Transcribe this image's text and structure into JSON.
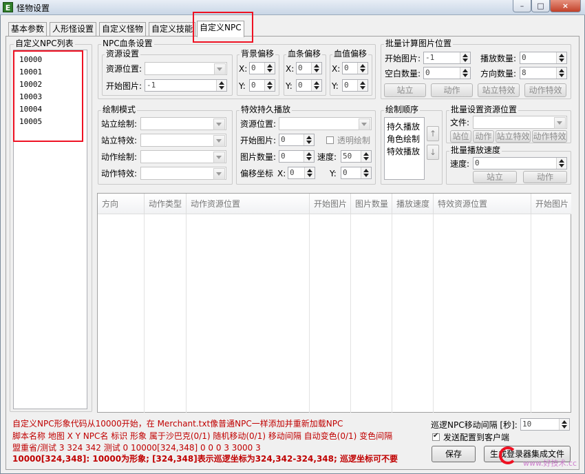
{
  "window": {
    "title": "怪物设置",
    "icon_letter": "E",
    "btn_minimize": "–",
    "btn_maximize": "□",
    "btn_close": "×"
  },
  "tabs": [
    "基本参数",
    "人形怪设置",
    "自定义怪物",
    "自定义技能",
    "自定义NPC"
  ],
  "npc_list": {
    "label": "自定义NPC列表",
    "items": [
      "10000",
      "10001",
      "10002",
      "10003",
      "10004",
      "10005"
    ]
  },
  "npc_hp": {
    "label": "NPC血条设置",
    "resource": {
      "label": "资源设置",
      "pos_label": "资源位置:",
      "start_label": "开始图片:",
      "start_value": "-1"
    },
    "bg_offset": {
      "label": "背景偏移",
      "x_label": "X:",
      "x": "0",
      "y_label": "Y:",
      "y": "0"
    },
    "bar_offset": {
      "label": "血条偏移",
      "x_label": "X:",
      "x": "0",
      "y_label": "Y:",
      "y": "0"
    },
    "val_offset": {
      "label": "血值偏移",
      "x_label": "X:",
      "x": "0",
      "y_label": "Y:",
      "y": "0"
    }
  },
  "batch_calc": {
    "label": "批量计算图片位置",
    "start_label": "开始图片:",
    "start_value": "-1",
    "count_label": "播放数量:",
    "count_value": "0",
    "blank_label": "空白数量:",
    "blank_value": "0",
    "dir_label": "方向数量:",
    "dir_value": "8",
    "buttons": [
      "站立",
      "动作",
      "站立特效",
      "动作特效"
    ]
  },
  "draw_mode": {
    "label": "绘制模式",
    "rows": [
      "站立绘制:",
      "站立特效:",
      "动作绘制:",
      "动作特效:"
    ]
  },
  "effect": {
    "label": "特效持久播放",
    "pos_label": "资源位置:",
    "start_label": "开始图片:",
    "start_value": "0",
    "transparent_label": "透明绘制",
    "count_label": "图片数量:",
    "count_value": "0",
    "speed_label": "速度:",
    "speed_value": "50",
    "offset_label": "偏移坐标",
    "x_label": "X:",
    "x": "0",
    "y_label": "Y:",
    "y": "0"
  },
  "draw_order": {
    "label": "绘制顺序",
    "items": [
      "持久播放",
      "角色绘制",
      "特效播放"
    ],
    "up": "↑",
    "down": "↓"
  },
  "batch_res": {
    "label": "批量设置资源位置",
    "file_label": "文件:",
    "buttons": [
      "站位",
      "动作",
      "站立特效",
      "动作特效"
    ]
  },
  "batch_speed": {
    "label": "批量播放速度",
    "speed_label": "速度:",
    "speed_value": "0",
    "buttons": [
      "站立",
      "动作"
    ]
  },
  "table": {
    "columns": [
      "方向",
      "动作类型",
      "动作资源位置",
      "开始图片",
      "图片数量",
      "播放速度",
      "特效资源位置",
      "开始图片"
    ]
  },
  "notes": [
    "自定义NPC形象代码从10000开始，在 Merchant.txt像普通NPC一样添加并重新加载NPC",
    "脚本名称 地图 X Y NPC名 标识 形象 属于沙巴克(0/1) 随机移动(0/1) 移动间隔 自动变色(0/1) 变色间隔",
    "盟重省/测试 3 324 342 测试 0 10000[324,348] 0 0 0 3 3000 3",
    "10000[324,348]: 10000为形象; [324,348]表示巡逻坐标为324,342-324,348; 巡逻坐标可不要"
  ],
  "patrol": {
    "label": "巡逻NPC移动间隔 [秒]:",
    "value": "10"
  },
  "send_config": {
    "label": "发送配置到客户端",
    "checked": true
  },
  "buttons": {
    "save": "保存",
    "generate": "生成登录器集成文件"
  },
  "watermark": "www.好技术.cc"
}
